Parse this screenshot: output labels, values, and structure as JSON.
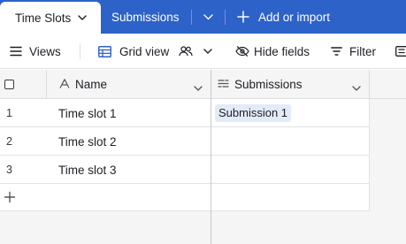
{
  "tabs": {
    "active": "Time Slots",
    "second": "Submissions",
    "add_import": "Add or import"
  },
  "toolbar": {
    "views": "Views",
    "grid_view": "Grid view",
    "hide_fields": "Hide fields",
    "filter": "Filter"
  },
  "columns": {
    "name": "Name",
    "submissions": "Submissions"
  },
  "rows": [
    {
      "num": "1",
      "name": "Time slot 1",
      "submission": "Submission 1"
    },
    {
      "num": "2",
      "name": "Time slot 2",
      "submission": ""
    },
    {
      "num": "3",
      "name": "Time slot 3",
      "submission": ""
    }
  ],
  "colors": {
    "tab_bar": "#2d62c9",
    "chip": "#e3ebf9",
    "header_bg": "#f5f5f5"
  }
}
